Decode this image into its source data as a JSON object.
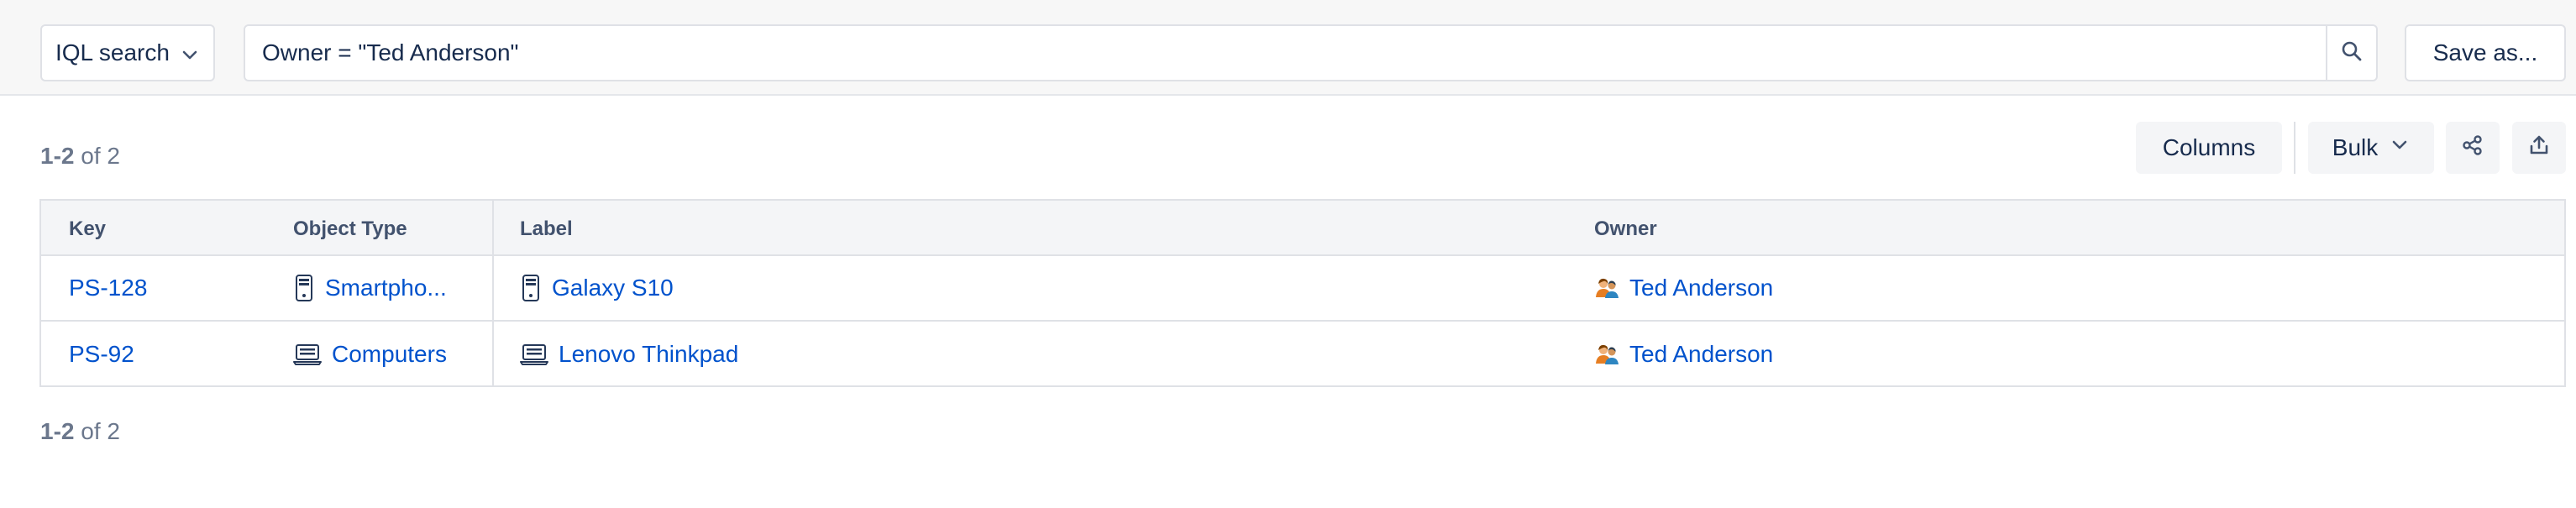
{
  "topbar": {
    "mode_select": "IQL search",
    "search_value": "Owner = \"Ted Anderson\"",
    "save_label": "Save as..."
  },
  "results": {
    "range": "1-2",
    "of_text": "of 2"
  },
  "toolbar": {
    "columns_label": "Columns",
    "bulk_label": "Bulk"
  },
  "table": {
    "headers": [
      "Key",
      "Object Type",
      "Label",
      "Owner"
    ],
    "rows": [
      {
        "key": "PS-128",
        "type": "Smartpho...",
        "type_icon": "smartphone-icon",
        "label": "Galaxy S10",
        "owner": "Ted Anderson"
      },
      {
        "key": "PS-92",
        "type": "Computers",
        "type_icon": "laptop-icon",
        "label": "Lenovo Thinkpad",
        "owner": "Ted Anderson"
      }
    ]
  },
  "colors": {
    "link": "#0052cc",
    "text": "#172b4d",
    "muted": "#6b778c",
    "border": "#dfe1e6",
    "header_bg": "#f4f5f7"
  }
}
